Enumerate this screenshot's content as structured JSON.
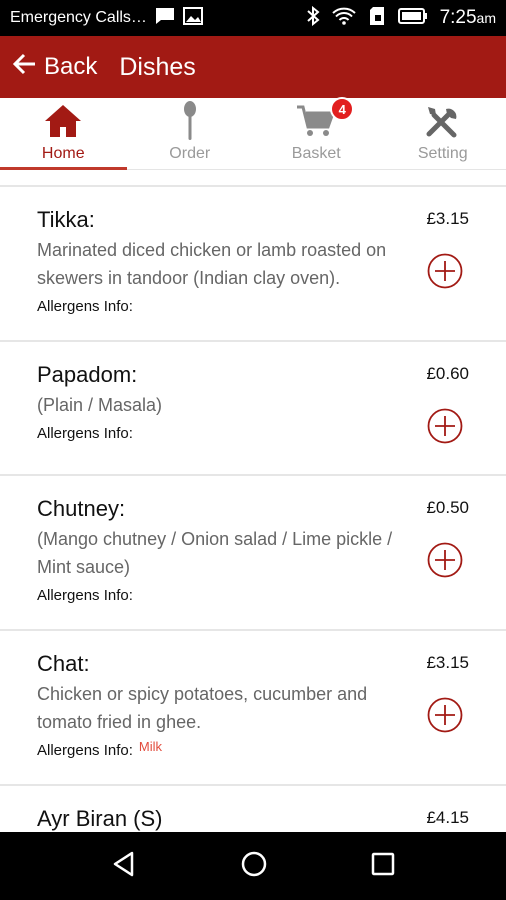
{
  "status_bar": {
    "carrier": "Emergency Calls…",
    "time": "7:25",
    "ampm": "am",
    "icons": [
      "message-icon",
      "image-icon",
      "bluetooth-icon",
      "wifi-icon",
      "sim-icon",
      "battery-icon"
    ]
  },
  "app_bar": {
    "back_label": "Back",
    "title": "Dishes",
    "color": "#a21a14"
  },
  "tabs": [
    {
      "label": "Home",
      "icon": "home-icon",
      "active": true
    },
    {
      "label": "Order",
      "icon": "spoon-icon",
      "active": false
    },
    {
      "label": "Basket",
      "icon": "cart-icon",
      "active": false,
      "badge": "4"
    },
    {
      "label": "Setting",
      "icon": "tools-icon",
      "active": false
    }
  ],
  "dishes": [
    {
      "name": "Tikka:",
      "price": "£3.15",
      "desc": "Marinated diced chicken or lamb roasted on skewers in tandoor (Indian clay oven).",
      "allergens_label": "Allergens Info:",
      "allergens": ""
    },
    {
      "name": "Papadom:",
      "price": "£0.60",
      "desc": "(Plain / Masala)",
      "allergens_label": "Allergens Info:",
      "allergens": ""
    },
    {
      "name": "Chutney:",
      "price": "£0.50",
      "desc": "(Mango chutney / Onion salad / Lime pickle / Mint sauce)",
      "allergens_label": "Allergens Info:",
      "allergens": ""
    },
    {
      "name": "Chat:",
      "price": "£3.15",
      "desc": "Chicken or spicy potatoes, cucumber and tomato fried in ghee.",
      "allergens_label": "Allergens Info:",
      "allergens": "Milk"
    },
    {
      "name": "Ayr Biran (S)",
      "price": "£4.15",
      "desc": "",
      "allergens_label": "",
      "allergens": ""
    }
  ],
  "nav_bar": {
    "icons": [
      "back-nav-icon",
      "home-nav-icon",
      "recents-nav-icon"
    ]
  }
}
